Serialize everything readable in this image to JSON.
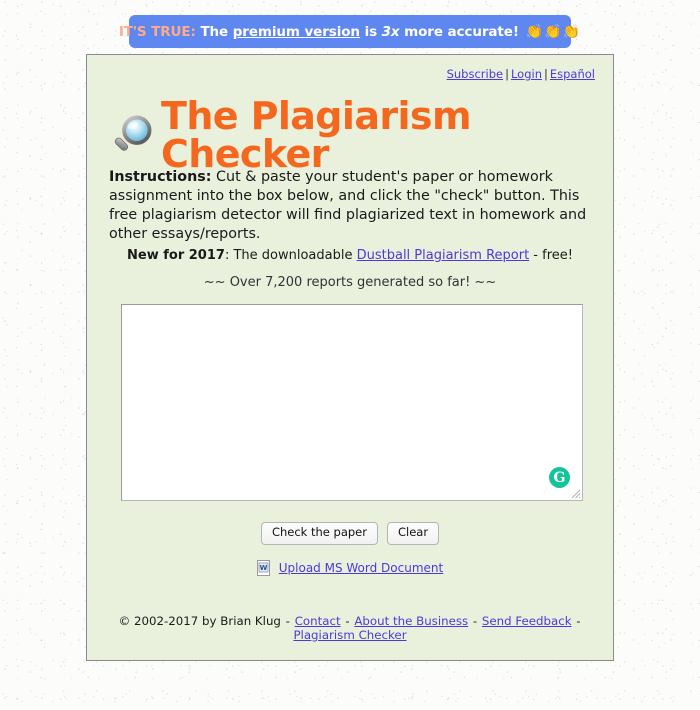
{
  "banner": {
    "highlight": "IT'S TRUE:",
    "text_before_link": "The",
    "link_label": "premium version",
    "text_middle": "is",
    "emphasis": "3x",
    "text_after": "more accurate!",
    "emoji": "👏👏👏",
    "background_color": "#5e87f0",
    "highlight_color": "#ffab8a"
  },
  "top_links": {
    "subscribe": "Subscribe",
    "login": "Login",
    "espanol": "Español",
    "separator": "|"
  },
  "header": {
    "title": "The Plagiarism Checker",
    "title_color": "#f4671f",
    "icon": "magnifier-icon"
  },
  "instructions": {
    "label": "Instructions:",
    "body": " Cut & paste your student's paper or homework assignment into the box below, and click the \"check\" button. This free plagiarism detector will find plagiarized text in homework and other essays/reports."
  },
  "promo_new": {
    "label": "New for 2017",
    "text_before": ": The downloadable ",
    "link_label": "Dustball Plagiarism Report",
    "text_after": " - free!"
  },
  "counter": {
    "text": "~~ Over 7,200 reports generated so far! ~~",
    "count": "7,200"
  },
  "textarea": {
    "value": "",
    "placeholder": "",
    "badge_label": "G",
    "badge_color": "#15c39a"
  },
  "buttons": {
    "check": "Check the paper",
    "clear": "Clear"
  },
  "upload": {
    "icon": "word-document-icon",
    "label": "Upload MS Word Document"
  },
  "footer": {
    "copyright": "© 2002-2017 by Brian Klug",
    "dash": "-",
    "links": [
      {
        "label": "Contact"
      },
      {
        "label": "About the Business"
      },
      {
        "label": "Send Feedback"
      },
      {
        "label": "Plagiarism Checker"
      }
    ]
  },
  "theme": {
    "panel_background": "#e9f1dd",
    "page_background": "#fcfcfb",
    "link_color": "#4b3ad6"
  }
}
